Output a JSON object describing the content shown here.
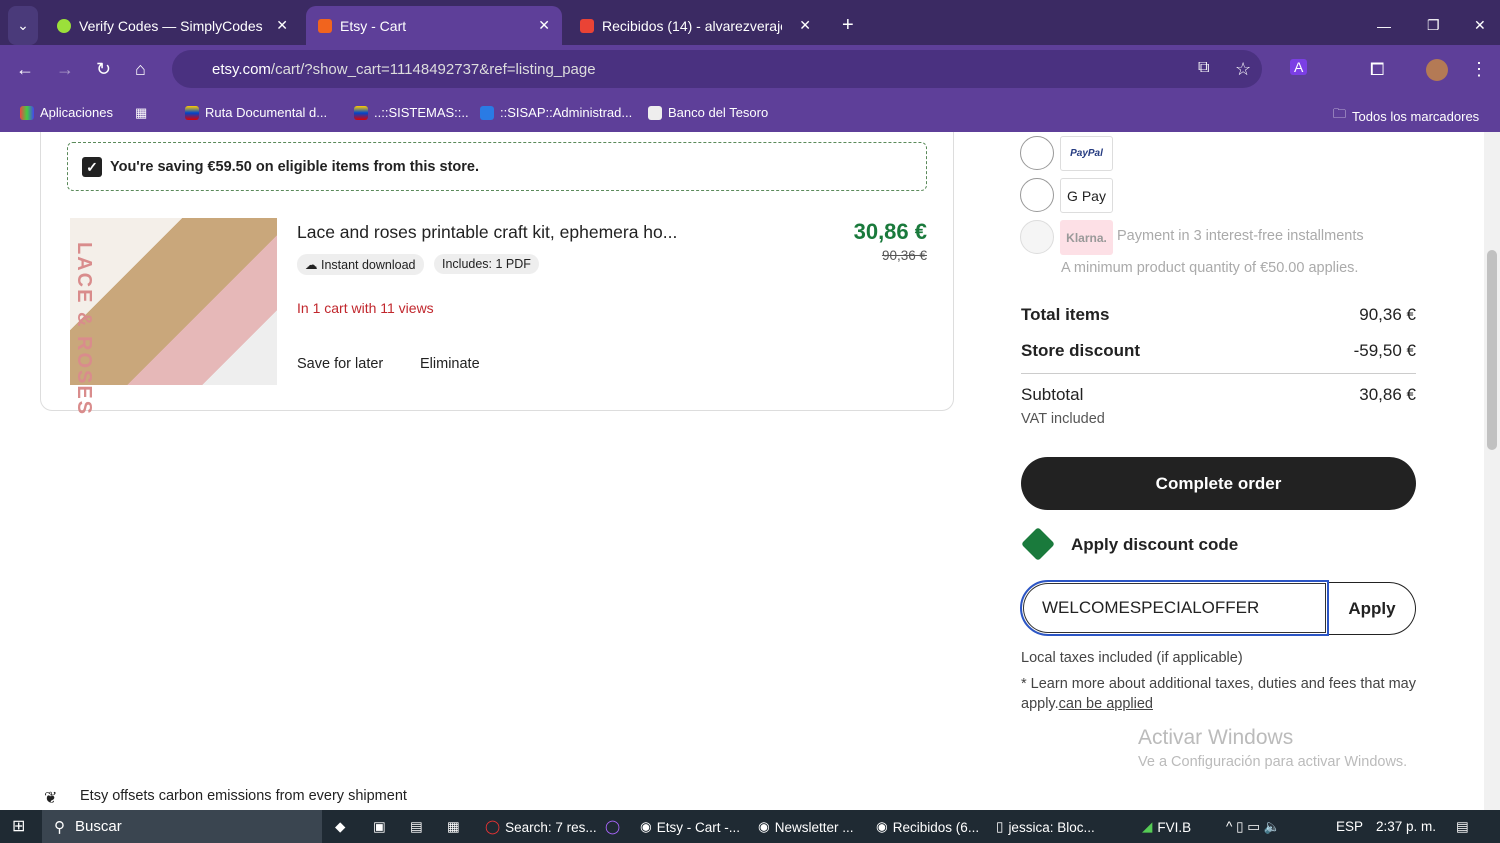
{
  "browser": {
    "tabs": [
      {
        "label": "Verify Codes — SimplyCodes"
      },
      {
        "label": "Etsy - Cart"
      },
      {
        "label": "Recibidos (14) - alvarezverajessi"
      }
    ],
    "url_domain": "etsy.com",
    "url_path": "/cart/?show_cart=11148492737&ref=listing_page",
    "bookmarks": [
      "Aplicaciones",
      "Ruta Documental d...",
      "..::SISTEMAS::..",
      "::SISAP::Administrad...",
      "Banco del Tesoro"
    ],
    "all_bookmarks": "Todos los marcadores"
  },
  "cart": {
    "saving_text": "You're saving €59.50 on eligible items from this store.",
    "item": {
      "title": "Lace and roses printable craft kit, ephemera ho...",
      "badge1": "Instant download",
      "badge2": "Includes: 1 PDF",
      "views": "In 1 cart with 11 views",
      "price": "30,86 €",
      "old_price": "90,36 €",
      "save": "Save for later",
      "remove": "Eliminate",
      "image_text": "LACE & ROSES"
    },
    "carbon": "Etsy offsets carbon emissions from every shipment"
  },
  "summary": {
    "paypal": "PayPal",
    "gpay": "G Pay",
    "klarna": "Klarna.",
    "klarna_text": "Payment in 3 interest-free installments",
    "klarna_min": "A minimum product quantity of €50.00 applies.",
    "total_items_label": "Total items",
    "total_items": "90,36 €",
    "discount_label": "Store discount",
    "discount": "-59,50 €",
    "subtotal_label": "Subtotal",
    "subtotal": "30,86 €",
    "vat": "VAT included",
    "complete": "Complete order",
    "apply_code": "Apply discount code",
    "code_value": "WELCOMESPECIALOFFER",
    "apply": "Apply",
    "taxes": "Local taxes included (if applicable)",
    "learn": "* Learn more about additional taxes, duties and fees that may apply.",
    "learn_link": "can be applied"
  },
  "watermark": {
    "title": "Activar Windows",
    "sub": "Ve a Configuración para activar Windows."
  },
  "taskbar": {
    "search": "Buscar",
    "apps": [
      "Search: 7 res...",
      "Etsy - Cart -...",
      "Newsletter ...",
      "Recibidos (6...",
      "jessica: Bloc..."
    ],
    "tray_app": "FVI.B",
    "lang": "ESP",
    "time": "2:37 p. m."
  }
}
